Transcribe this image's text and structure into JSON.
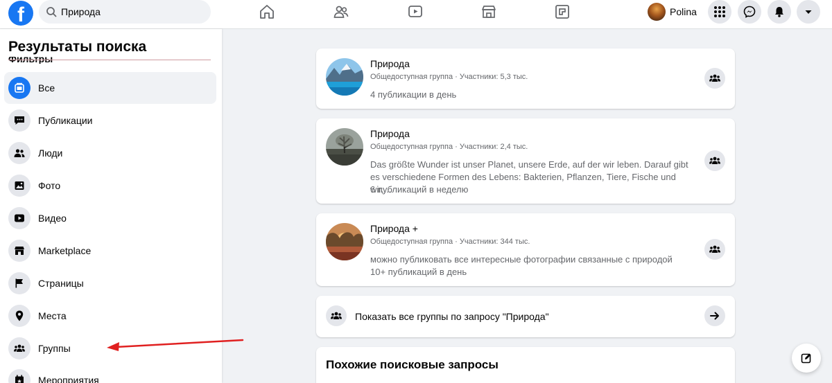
{
  "header": {
    "logo_letter": "f",
    "search": {
      "value": "Природа"
    },
    "profile": {
      "name": "Polina"
    }
  },
  "sidebar": {
    "title": "Результаты поиска",
    "filters_label": "Фильтры",
    "items": [
      {
        "label": "Все",
        "icon": "all-results-icon",
        "active": true
      },
      {
        "label": "Публикации",
        "icon": "posts-icon"
      },
      {
        "label": "Люди",
        "icon": "people-icon"
      },
      {
        "label": "Фото",
        "icon": "photo-icon"
      },
      {
        "label": "Видео",
        "icon": "video-icon"
      },
      {
        "label": "Marketplace",
        "icon": "marketplace-icon"
      },
      {
        "label": "Страницы",
        "icon": "flag-icon"
      },
      {
        "label": "Места",
        "icon": "location-pin-icon"
      },
      {
        "label": "Группы",
        "icon": "groups-icon"
      },
      {
        "label": "Мероприятия",
        "icon": "calendar-icon"
      }
    ]
  },
  "results": [
    {
      "name": "Природа",
      "meta": "Общедоступная группа · Участники: 5,3 тыс.",
      "desc": "",
      "activity": "4 публикации в день"
    },
    {
      "name": "Природа",
      "meta": "Общедоступная группа · Участники: 2,4 тыс.",
      "desc": "Das größte Wunder ist unser Planet, unsere Erde, auf der wir leben. Darauf gibt es verschiedene Formen des Lebens: Bakterien, Pflanzen, Tiere, Fische und wir,...",
      "activity": "6 публикаций в неделю"
    },
    {
      "name": "Природа +",
      "meta": "Общедоступная группа · Участники: 344 тыс.",
      "desc": "можно публиковать все интересные фотографии связанные с природой",
      "activity": "10+ публикаций в день"
    }
  ],
  "show_all": {
    "label": "Показать все группы по запросу \"Природа\""
  },
  "related": {
    "title": "Похожие поисковые запросы"
  },
  "colors": {
    "brand": "#1877f2",
    "annotation_arrow": "#e02020"
  }
}
